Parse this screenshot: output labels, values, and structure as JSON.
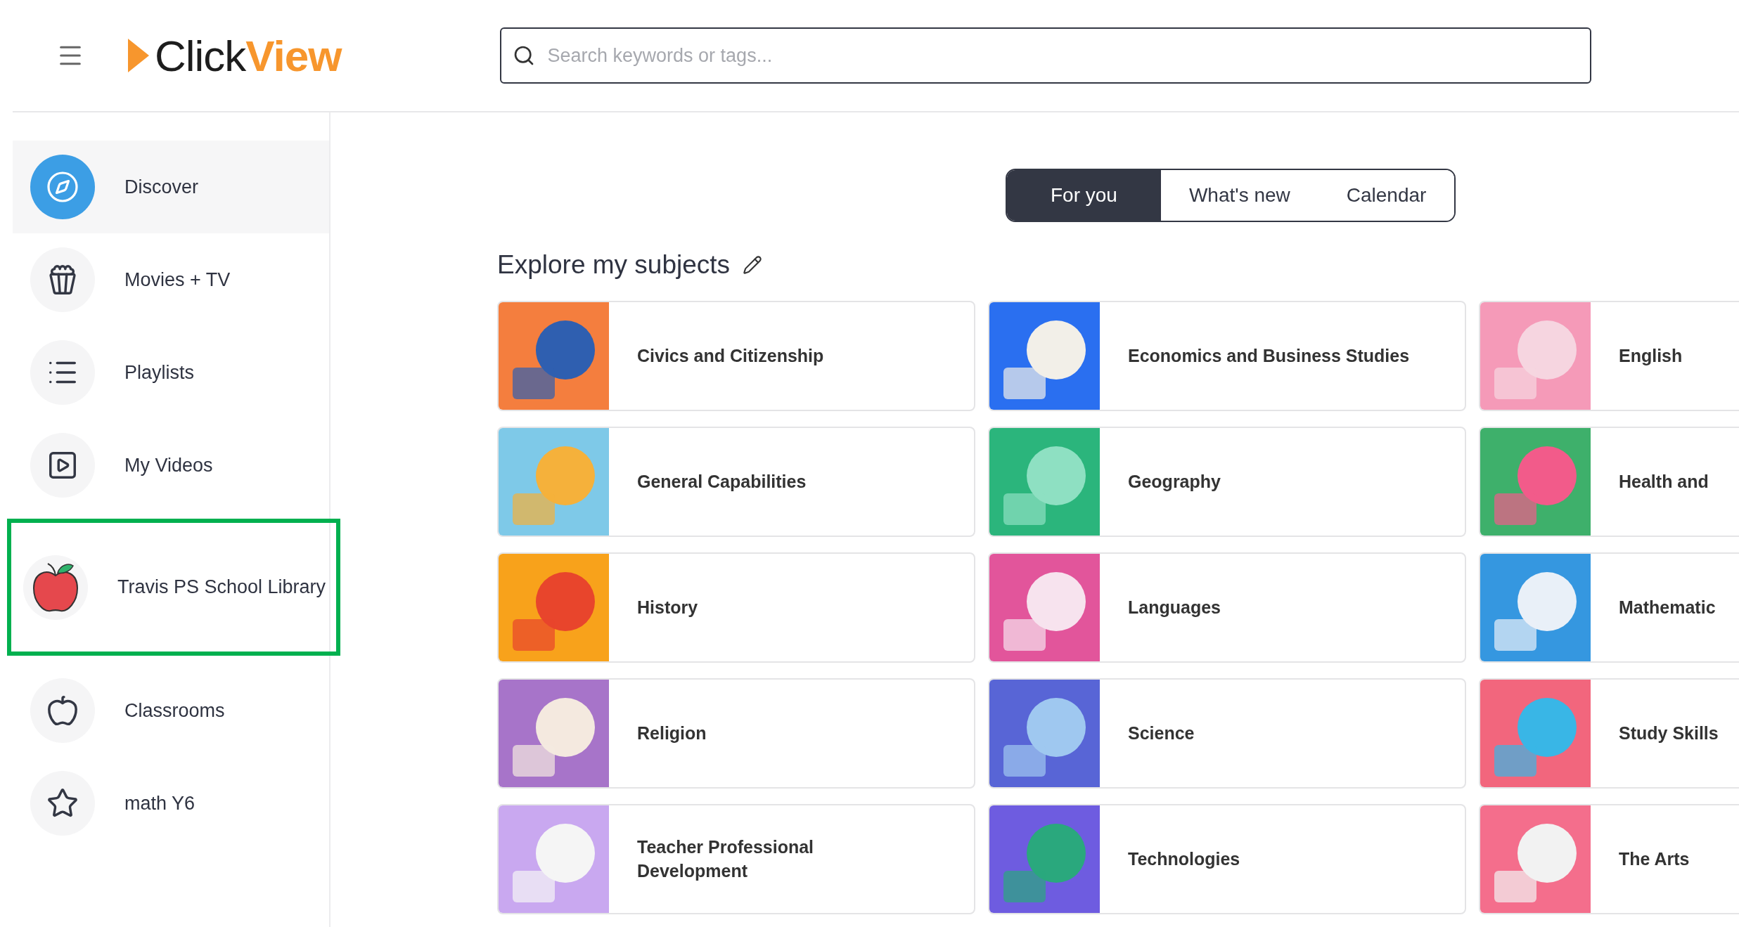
{
  "header": {
    "logo": "Click**View**",
    "search": {
      "placeholder": "Search keywords or tags..."
    }
  },
  "sidebar": {
    "items": [
      {
        "label": "Discover",
        "kind": "compass",
        "selected": true,
        "highlighted": false
      },
      {
        "label": "Movies + TV",
        "kind": "popcorn",
        "selected": false,
        "highlighted": false
      },
      {
        "label": "Playlists",
        "kind": "list",
        "selected": false,
        "highlighted": false
      },
      {
        "label": "My Videos",
        "kind": "video",
        "selected": false,
        "highlighted": false
      },
      {
        "label": "Travis PS School Library",
        "kind": "red-apple",
        "selected": false,
        "highlighted": true
      },
      {
        "label": "Classrooms",
        "kind": "apple",
        "selected": false,
        "highlighted": false
      },
      {
        "label": "math Y6",
        "kind": "star",
        "selected": false,
        "highlighted": false
      }
    ]
  },
  "tabs": [
    {
      "label": "For you",
      "selected": true
    },
    {
      "label": "What's new",
      "selected": false
    },
    {
      "label": "Calendar",
      "selected": false
    }
  ],
  "section": {
    "title": "Explore my subjects",
    "subjects": [
      {
        "label": "Civics and Citizenship"
      },
      {
        "label": "Economics and Business Studies"
      },
      {
        "label": "English"
      },
      {
        "label": "General Capabilities"
      },
      {
        "label": "Geography"
      },
      {
        "label": "Health and"
      },
      {
        "label": "History"
      },
      {
        "label": "Languages"
      },
      {
        "label": "Mathematic"
      },
      {
        "label": "Religion"
      },
      {
        "label": "Science"
      },
      {
        "label": "Study Skills"
      },
      {
        "label": "Teacher Professional Development"
      },
      {
        "label": "Technologies"
      },
      {
        "label": "The Arts"
      }
    ]
  }
}
